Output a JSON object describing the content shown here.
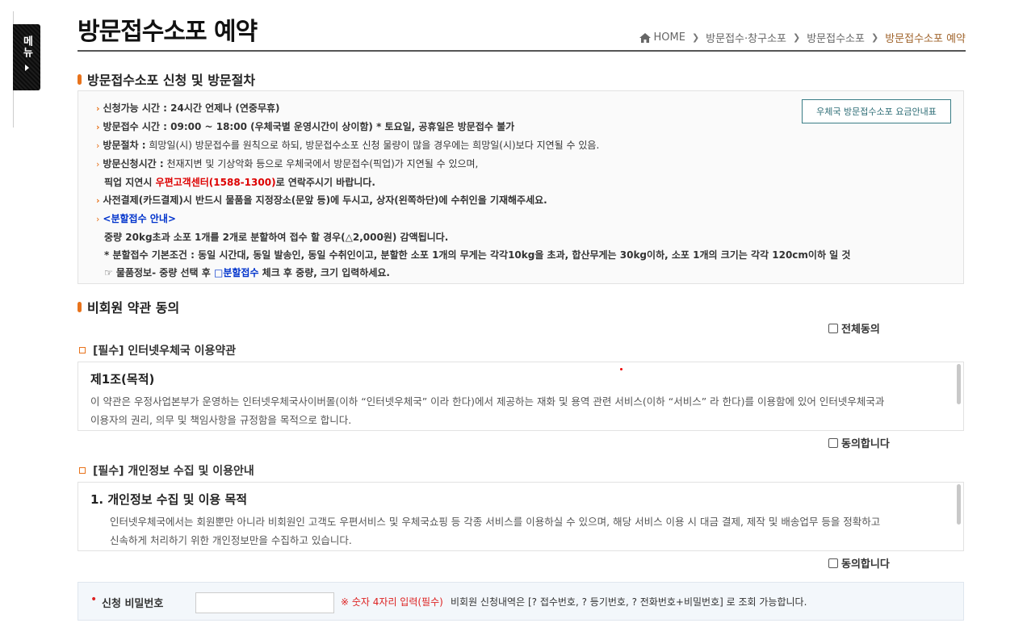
{
  "side_menu": {
    "label": "메뉴"
  },
  "header": {
    "title": "방문접수소포 예약",
    "breadcrumb": [
      "HOME",
      "방문접수·창구소포",
      "방문접수소포",
      "방문접수소포 예약"
    ]
  },
  "section1": {
    "title": "방문접수소포 신청 및 방문절차",
    "fee_button": "우체국 방문접수소포 요금안내표",
    "lines": {
      "l1": "신청가능 시간 : 24시간 언제나 (연중무휴)",
      "l2": "방문접수 시간 : 09:00 ~ 18:00 (우체국별 운영시간이 상이함) * 토요일, 공휴일은 방문접수 불가",
      "l3_label": "방문절차 :",
      "l3_text": " 희망일(시) 방문접수를 원칙으로 하되, 방문접수소포 신청 물량이 많을 경우에는 희망일(시)보다 지연될 수 있음.",
      "l4_label": "방문신청시간 :",
      "l4_text": " 천재지변 및 기상악화 등으로 우체국에서 방문접수(픽업)가 지연될 수 있으며,",
      "l5_pre": "픽업 지연시 ",
      "l5_red": "우편고객센터(1588-1300)",
      "l5_post": "로 연락주시기 바랍니다.",
      "l6": "사전결제(카드결제)시 반드시 물품을 지정장소(문앞 등)에 두시고, 상자(왼쪽하단)에 수취인을 기재해주세요.",
      "l7": "<분할접수 안내>",
      "l8": "중량 20kg초과 소포 1개를 2개로 분할하여 접수 할 경우(△2,000원) 감액됩니다.",
      "l9": "* 분할접수 기본조건 : 동일 시간대, 동일 발송인, 동일 수취인이고, 분할한 소포 1개의 무게는 각각10kg을 초과, 합산무게는 30kg이하, 소포 1개의 크기는 각각 120cm이하 일 것",
      "l10_pre": "☞ 물품정보- 중량 선택 후 ",
      "l10_blue": "□분할접수",
      "l10_post": " 체크 후 중량, 크기 입력하세요."
    }
  },
  "section2": {
    "title": "비회원 약관 동의",
    "agree_all": "전체동의",
    "terms1": {
      "title": "[필수] 인터넷우체국 이용약관",
      "heading": "제1조(목적)",
      "p1": "이 약관은 우정사업본부가 운영하는 인터넷우체국사이버몰(이하 “인터넷우체국” 이라 한다)에서 제공하는 재화 및 용역 관련 서비스(이하 “서비스” 라 한다)를 이용함에 있어 인터넷우체국과",
      "p2": "이용자의 권리, 의무 및 책임사항을 규정함을 목적으로 합니다.",
      "agree": "동의합니다"
    },
    "terms2": {
      "title": "[필수] 개인정보 수집 및 이용안내",
      "heading": "1. 개인정보 수집 및 이용 목적",
      "p1": "인터넷우체국에서는 회원뿐만 아니라 비회원인 고객도 우편서비스 및 우체국쇼핑 등 각종 서비스를 이용하실 수 있으며, 해당 서비스 이용 시 대금 결제, 제작 및 배송업무 등을 정확하고",
      "p2": "신속하게 처리하기 위한 개인정보만을 수집하고 있습니다.",
      "agree": "동의합니다"
    }
  },
  "password": {
    "label": "신청 비밀번호",
    "value": "",
    "hint": "※ 숫자 4자리 입력(필수)",
    "info": "비회원 신청내역은 [? 접수번호, ? 등기번호, ? 전화번호+비밀번호] 로 조회 가능합니다."
  }
}
